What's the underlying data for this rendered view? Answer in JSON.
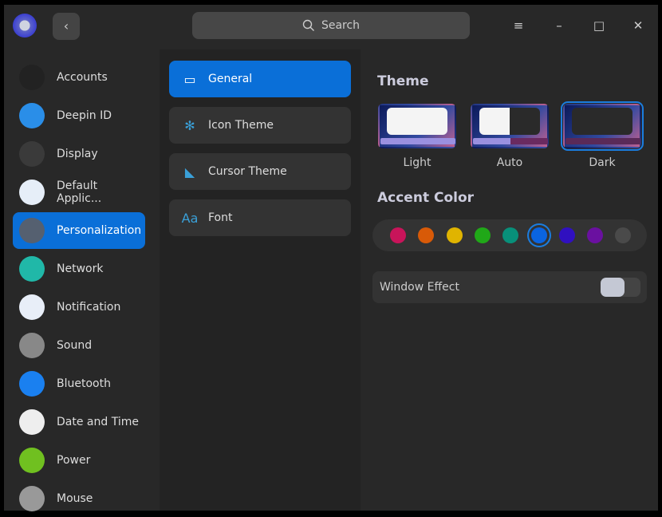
{
  "titlebar": {
    "back": "‹",
    "search_placeholder": "Search",
    "menu": "≡",
    "minimize": "–",
    "maximize": "□",
    "close": "✕"
  },
  "sidebar": {
    "items": [
      {
        "label": "Accounts",
        "icon": "user-icon",
        "color": "#222"
      },
      {
        "label": "Deepin ID",
        "icon": "cloud-icon",
        "color": "#2a8ee8"
      },
      {
        "label": "Display",
        "icon": "monitor-icon",
        "color": "#3a3a3a"
      },
      {
        "label": "Default Applic...",
        "icon": "default-apps-icon",
        "color": "#e6eef8"
      },
      {
        "label": "Personalization",
        "icon": "palette-icon",
        "color": "#556070"
      },
      {
        "label": "Network",
        "icon": "network-icon",
        "color": "#20b8a8"
      },
      {
        "label": "Notification",
        "icon": "notification-icon",
        "color": "#e8eef8"
      },
      {
        "label": "Sound",
        "icon": "speaker-icon",
        "color": "#888"
      },
      {
        "label": "Bluetooth",
        "icon": "bluetooth-icon",
        "color": "#1a80f0"
      },
      {
        "label": "Date and Time",
        "icon": "clock-icon",
        "color": "#eee"
      },
      {
        "label": "Power",
        "icon": "battery-icon",
        "color": "#70c020"
      },
      {
        "label": "Mouse",
        "icon": "mouse-icon",
        "color": "#999"
      }
    ],
    "active": 4
  },
  "subnav": {
    "items": [
      {
        "label": "General",
        "icon": "window-icon",
        "glyph": "▭"
      },
      {
        "label": "Icon Theme",
        "icon": "snowflake-icon",
        "glyph": "✻"
      },
      {
        "label": "Cursor Theme",
        "icon": "cursor-icon",
        "glyph": "◣"
      },
      {
        "label": "Font",
        "icon": "font-icon",
        "glyph": "Aa"
      }
    ],
    "active": 0
  },
  "theme": {
    "title": "Theme",
    "options": [
      {
        "label": "Light"
      },
      {
        "label": "Auto"
      },
      {
        "label": "Dark"
      }
    ],
    "selected": "Dark"
  },
  "accent": {
    "title": "Accent Color",
    "colors": [
      "#c8145a",
      "#d85a08",
      "#e0b400",
      "#20a818",
      "#08907a",
      "#0a64e0",
      "#3010c0",
      "#6a10a0",
      "#4a4a4a"
    ],
    "selected": 5
  },
  "window_effect": {
    "label": "Window Effect",
    "enabled": false
  }
}
